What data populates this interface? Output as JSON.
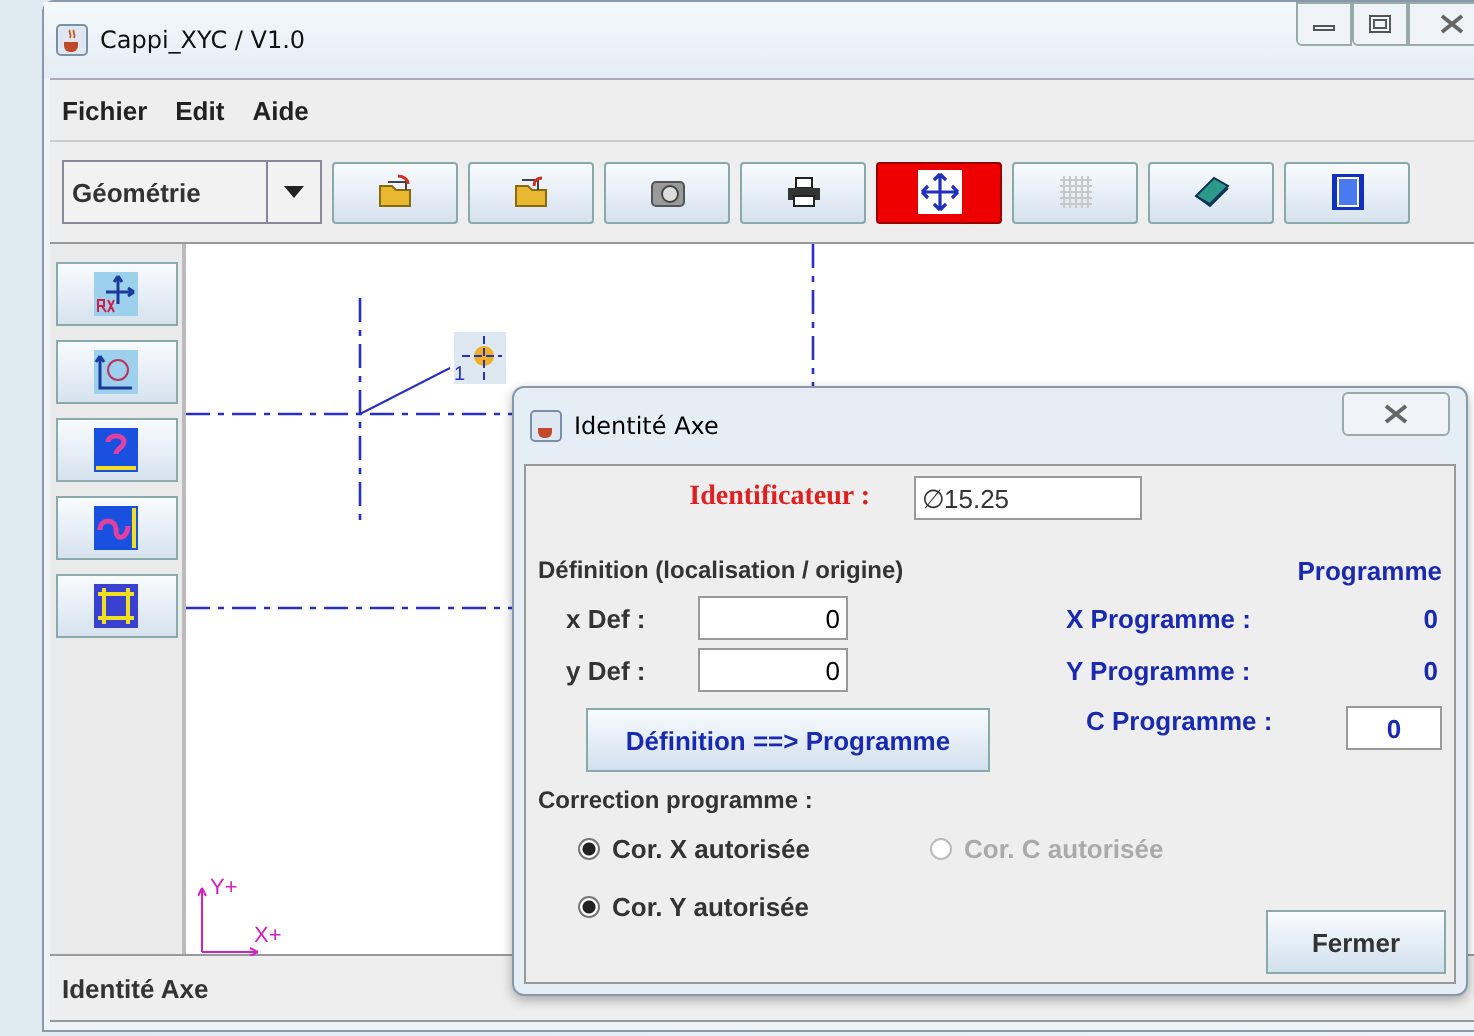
{
  "window": {
    "title": "Cappi_XYC / V1.0"
  },
  "menu": [
    "Fichier",
    "Edit",
    "Aide"
  ],
  "toolbar": {
    "combo": {
      "value": "Géométrie"
    },
    "buttons": [
      {
        "kind": "open",
        "selected": false
      },
      {
        "kind": "save",
        "selected": false
      },
      {
        "kind": "camera",
        "selected": false
      },
      {
        "kind": "print",
        "selected": false
      },
      {
        "kind": "move",
        "selected": true
      },
      {
        "kind": "grid",
        "selected": false
      },
      {
        "kind": "book",
        "selected": false
      },
      {
        "kind": "exit",
        "selected": false
      }
    ]
  },
  "tools": [
    {
      "kind": "origin"
    },
    {
      "kind": "circle-axis"
    },
    {
      "kind": "question"
    },
    {
      "kind": "curve"
    },
    {
      "kind": "arrows"
    }
  ],
  "canvas": {
    "node_label": "1",
    "axis_y": "Y+",
    "axis_x": "X+"
  },
  "status_bar": "Identité Axe",
  "dialog": {
    "title": "Identité Axe",
    "id_label": "Identificateur :",
    "id_value": "∅15.25",
    "definition_heading": "Définition (localisation / origine)",
    "program_heading": "Programme",
    "x_def_label": "x Def :",
    "x_def_value": "0",
    "y_def_label": "y Def :",
    "y_def_value": "0",
    "x_prog_label": "X Programme :",
    "x_prog_value": "0",
    "y_prog_label": "Y Programme :",
    "y_prog_value": "0",
    "transfer_button": "Définition ==> Programme",
    "c_prog_label": "C Programme :",
    "c_prog_value": "0",
    "correction_heading": "Correction programme :",
    "options": [
      {
        "label": "Cor. X autorisée",
        "checked": true,
        "disabled": false
      },
      {
        "label": "Cor. C autorisée",
        "checked": false,
        "disabled": true
      },
      {
        "label": "Cor. Y autorisée",
        "checked": true,
        "disabled": false
      }
    ],
    "close_button": "Fermer"
  }
}
